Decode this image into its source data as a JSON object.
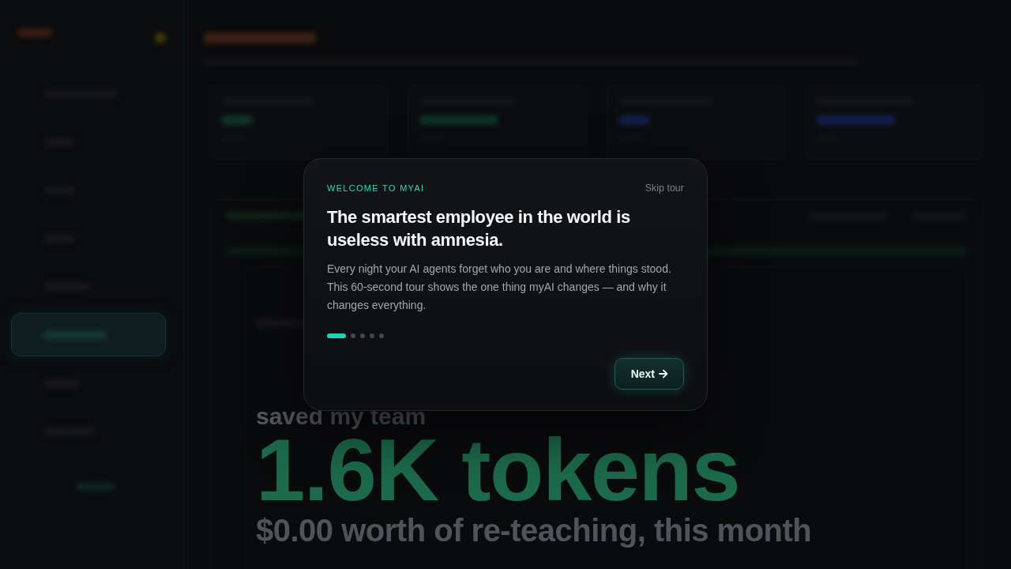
{
  "sidebar": {
    "items": [
      {
        "selected": false
      },
      {
        "selected": false
      },
      {
        "selected": false
      },
      {
        "selected": false
      },
      {
        "selected": false
      },
      {
        "selected": true
      },
      {
        "selected": false
      },
      {
        "selected": false
      }
    ]
  },
  "dashboard": {
    "hero": {
      "label": "saved my team",
      "value": "1.6K tokens",
      "caption": "$0.00 worth of re-teaching, this month"
    }
  },
  "tour_dialog": {
    "eyebrow": "WELCOME TO MYAI",
    "skip_button": "Skip tour",
    "title": "The smartest employee in the world is useless with amnesia.",
    "body": "Every night your AI agents forget who you are and where things stood. This 60-second tour shows the one thing myAI changes — and why it changes everything.",
    "steps": [
      {
        "selected": true
      },
      {
        "selected": false
      },
      {
        "selected": false
      },
      {
        "selected": false
      },
      {
        "selected": false
      }
    ],
    "next_button": "Next"
  }
}
